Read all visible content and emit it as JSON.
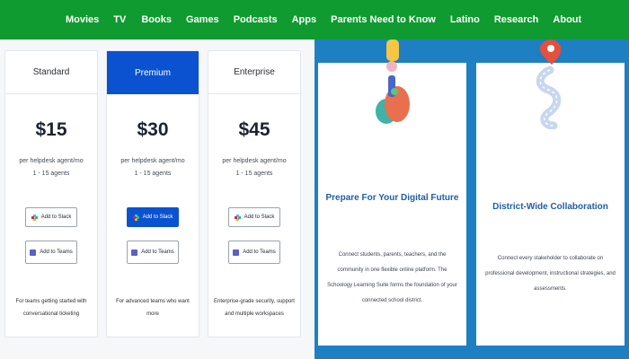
{
  "nav": {
    "items": [
      "Movies",
      "TV",
      "Books",
      "Games",
      "Podcasts",
      "Apps",
      "Parents Need to Know",
      "Latino",
      "Research",
      "About"
    ]
  },
  "pricing": {
    "plans": [
      {
        "name": "Standard",
        "price": "$15",
        "desc_line1": "per helpdesk agent/mo",
        "desc_line2": "1 - 15 agents",
        "slack_label": "Add to Slack",
        "teams_label": "Add to Teams",
        "foot": "For teams getting started with conversational ticketing"
      },
      {
        "name": "Premium",
        "price": "$30",
        "desc_line1": "per helpdesk agent/mo",
        "desc_line2": "1 - 15 agents",
        "slack_label": "Add to Slack",
        "teams_label": "Add to Teams",
        "foot": "For advanced teams who want more"
      },
      {
        "name": "Enterprise",
        "price": "$45",
        "desc_line1": "per helpdesk agent/mo",
        "desc_line2": "1 - 15 agents",
        "slack_label": "Add to Slack",
        "teams_label": "Add to Teams",
        "foot": "Enterprise-grade security, support and multiple workspaces"
      }
    ]
  },
  "features": {
    "cards": [
      {
        "title": "Prepare For Your Digital Future",
        "text": "Connect students, parents, teachers, and the community in one flexible online platform. The Schoology Learning Suite forms the foundation of your connected school district."
      },
      {
        "title": "District-Wide Collaboration",
        "text": "Connect every stakeholder to collaborate on professional development, instructional strategies, and assessments."
      }
    ]
  },
  "colors": {
    "nav_bg": "#0f9b2f",
    "premium_blue": "#0b52d1",
    "feature_bg": "#1f7fc3",
    "feature_title": "#1f5ea8"
  }
}
